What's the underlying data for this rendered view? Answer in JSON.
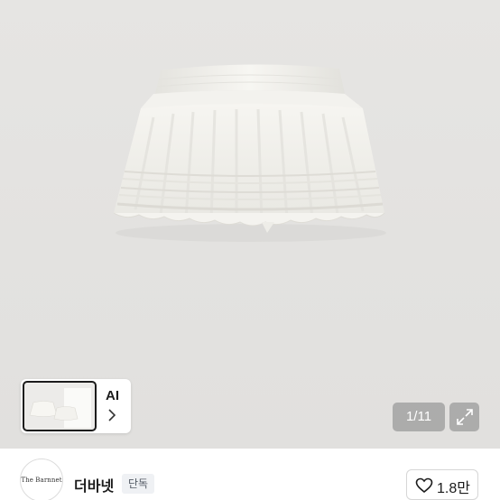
{
  "gallery": {
    "counter": "1/11",
    "ai_label": "AI",
    "image_subject": "white ruffled tiered mini skirt"
  },
  "seller": {
    "logo_text": "The Barnnet",
    "name": "더바넷",
    "badge": "단독",
    "like_count": "1.8만"
  },
  "icons": {
    "expand": "expand-icon",
    "heart": "heart-icon",
    "chevron": "chevron-right-icon"
  }
}
